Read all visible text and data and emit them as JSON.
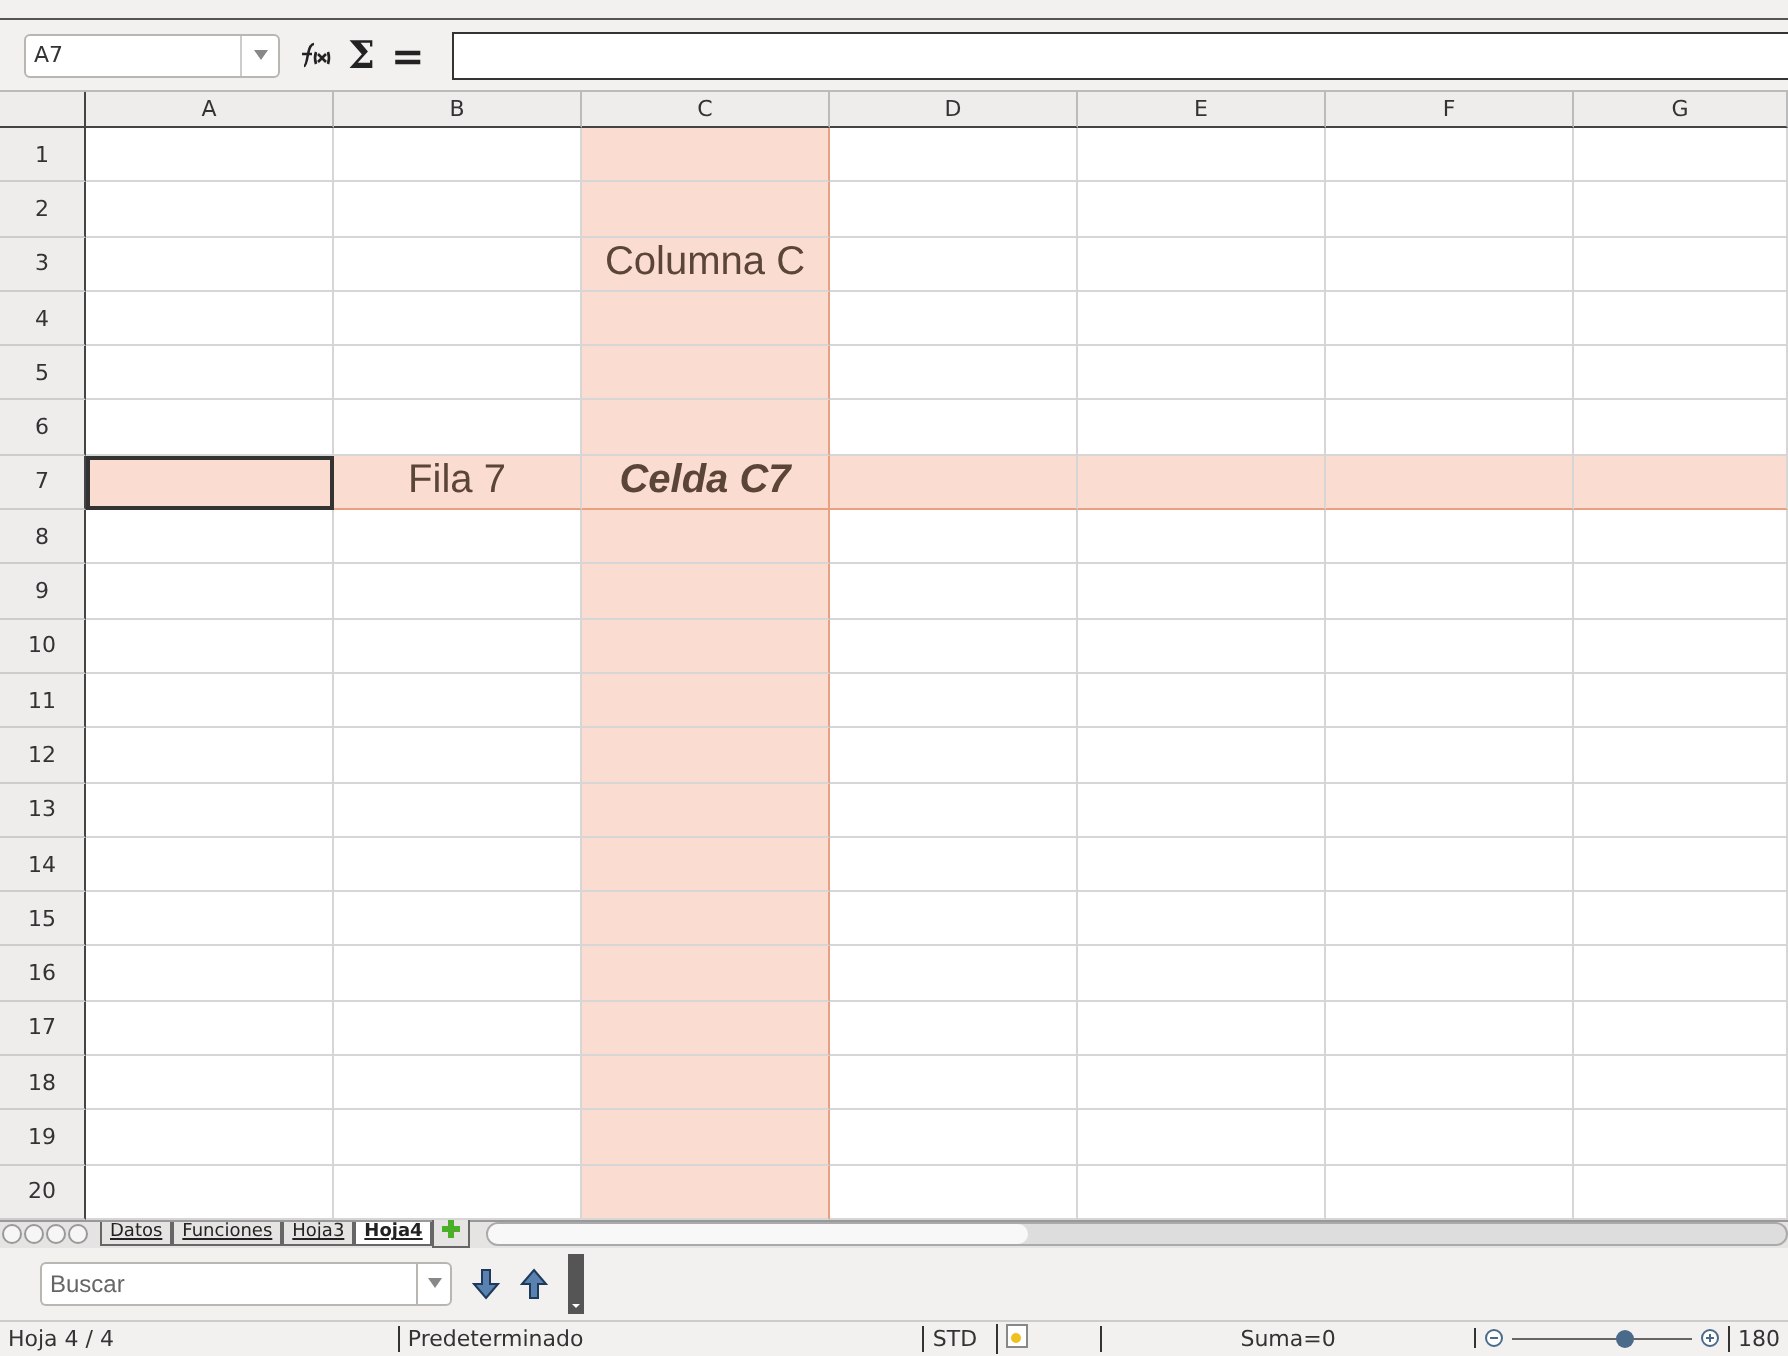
{
  "name_box": {
    "value": "A7"
  },
  "formula_toolbar": {
    "sum_symbol": "Σ",
    "equals_symbol": "="
  },
  "columns": [
    {
      "label": "A",
      "highlighted": false
    },
    {
      "label": "B",
      "highlighted": false
    },
    {
      "label": "C",
      "highlighted": true
    },
    {
      "label": "D",
      "highlighted": false
    },
    {
      "label": "E",
      "highlighted": false
    },
    {
      "label": "F",
      "highlighted": false
    },
    {
      "label": "G",
      "highlighted": false
    }
  ],
  "rows": [
    {
      "label": "1",
      "highlighted": false,
      "cells": [
        {
          "selected": false
        },
        {
          "selected": false
        },
        {
          "selected": false
        },
        {
          "selected": false
        },
        {
          "selected": false
        },
        {
          "selected": false
        },
        {
          "selected": false
        }
      ]
    },
    {
      "label": "2",
      "highlighted": false,
      "cells": [
        {
          "selected": false
        },
        {
          "selected": false
        },
        {
          "selected": false
        },
        {
          "selected": false
        },
        {
          "selected": false
        },
        {
          "selected": false
        },
        {
          "selected": false
        }
      ]
    },
    {
      "label": "3",
      "highlighted": false,
      "cells": [
        {
          "selected": false
        },
        {
          "selected": false
        },
        {
          "text": "Columna C",
          "selected": false
        },
        {
          "selected": false
        },
        {
          "selected": false
        },
        {
          "selected": false
        },
        {
          "selected": false
        }
      ]
    },
    {
      "label": "4",
      "highlighted": false,
      "cells": [
        {
          "selected": false
        },
        {
          "selected": false
        },
        {
          "selected": false
        },
        {
          "selected": false
        },
        {
          "selected": false
        },
        {
          "selected": false
        },
        {
          "selected": false
        }
      ]
    },
    {
      "label": "5",
      "highlighted": false,
      "cells": [
        {
          "selected": false
        },
        {
          "selected": false
        },
        {
          "selected": false
        },
        {
          "selected": false
        },
        {
          "selected": false
        },
        {
          "selected": false
        },
        {
          "selected": false
        }
      ]
    },
    {
      "label": "6",
      "highlighted": false,
      "cells": [
        {
          "selected": false
        },
        {
          "selected": false
        },
        {
          "selected": false
        },
        {
          "selected": false
        },
        {
          "selected": false
        },
        {
          "selected": false
        },
        {
          "selected": false
        }
      ]
    },
    {
      "label": "7",
      "highlighted": true,
      "cells": [
        {
          "selected": true
        },
        {
          "text": "Fila 7",
          "selected": false
        },
        {
          "text": "Celda C7",
          "bold": true,
          "italic": true,
          "selected": false
        },
        {
          "selected": false
        },
        {
          "selected": false
        },
        {
          "selected": false
        },
        {
          "selected": false
        }
      ]
    },
    {
      "label": "8",
      "highlighted": false,
      "cells": [
        {
          "selected": false
        },
        {
          "selected": false
        },
        {
          "selected": false
        },
        {
          "selected": false
        },
        {
          "selected": false
        },
        {
          "selected": false
        },
        {
          "selected": false
        }
      ]
    },
    {
      "label": "9",
      "highlighted": false,
      "cells": [
        {
          "selected": false
        },
        {
          "selected": false
        },
        {
          "selected": false
        },
        {
          "selected": false
        },
        {
          "selected": false
        },
        {
          "selected": false
        },
        {
          "selected": false
        }
      ]
    },
    {
      "label": "10",
      "highlighted": false,
      "cells": [
        {
          "selected": false
        },
        {
          "selected": false
        },
        {
          "selected": false
        },
        {
          "selected": false
        },
        {
          "selected": false
        },
        {
          "selected": false
        },
        {
          "selected": false
        }
      ]
    },
    {
      "label": "11",
      "highlighted": false,
      "cells": [
        {
          "selected": false
        },
        {
          "selected": false
        },
        {
          "selected": false
        },
        {
          "selected": false
        },
        {
          "selected": false
        },
        {
          "selected": false
        },
        {
          "selected": false
        }
      ]
    },
    {
      "label": "12",
      "highlighted": false,
      "cells": [
        {
          "selected": false
        },
        {
          "selected": false
        },
        {
          "selected": false
        },
        {
          "selected": false
        },
        {
          "selected": false
        },
        {
          "selected": false
        },
        {
          "selected": false
        }
      ]
    },
    {
      "label": "13",
      "highlighted": false,
      "cells": [
        {
          "selected": false
        },
        {
          "selected": false
        },
        {
          "selected": false
        },
        {
          "selected": false
        },
        {
          "selected": false
        },
        {
          "selected": false
        },
        {
          "selected": false
        }
      ]
    },
    {
      "label": "14",
      "highlighted": false,
      "cells": [
        {
          "selected": false
        },
        {
          "selected": false
        },
        {
          "selected": false
        },
        {
          "selected": false
        },
        {
          "selected": false
        },
        {
          "selected": false
        },
        {
          "selected": false
        }
      ]
    },
    {
      "label": "15",
      "highlighted": false,
      "cells": [
        {
          "selected": false
        },
        {
          "selected": false
        },
        {
          "selected": false
        },
        {
          "selected": false
        },
        {
          "selected": false
        },
        {
          "selected": false
        },
        {
          "selected": false
        }
      ]
    },
    {
      "label": "16",
      "highlighted": false,
      "cells": [
        {
          "selected": false
        },
        {
          "selected": false
        },
        {
          "selected": false
        },
        {
          "selected": false
        },
        {
          "selected": false
        },
        {
          "selected": false
        },
        {
          "selected": false
        }
      ]
    },
    {
      "label": "17",
      "highlighted": false,
      "cells": [
        {
          "selected": false
        },
        {
          "selected": false
        },
        {
          "selected": false
        },
        {
          "selected": false
        },
        {
          "selected": false
        },
        {
          "selected": false
        },
        {
          "selected": false
        }
      ]
    },
    {
      "label": "18",
      "highlighted": false,
      "cells": [
        {
          "selected": false
        },
        {
          "selected": false
        },
        {
          "selected": false
        },
        {
          "selected": false
        },
        {
          "selected": false
        },
        {
          "selected": false
        },
        {
          "selected": false
        }
      ]
    },
    {
      "label": "19",
      "highlighted": false,
      "cells": [
        {
          "selected": false
        },
        {
          "selected": false
        },
        {
          "selected": false
        },
        {
          "selected": false
        },
        {
          "selected": false
        },
        {
          "selected": false
        },
        {
          "selected": false
        }
      ]
    },
    {
      "label": "20",
      "highlighted": false,
      "cells": [
        {
          "selected": false
        },
        {
          "selected": false
        },
        {
          "selected": false
        },
        {
          "selected": false
        },
        {
          "selected": false
        },
        {
          "selected": false
        },
        {
          "selected": false
        }
      ]
    }
  ],
  "sheet_tabs": [
    {
      "label": "Datos",
      "selected": false
    },
    {
      "label": "Funciones",
      "selected": false
    },
    {
      "label": "Hoja3",
      "selected": false
    },
    {
      "label": "Hoja4",
      "selected": true
    }
  ],
  "find_bar": {
    "placeholder": "Buscar"
  },
  "status_bar": {
    "sheet": "Hoja 4 / 4",
    "page_style": "Predeterminado",
    "mode": "STD",
    "sum": "Suma=0",
    "zoom": {
      "level": 0.62,
      "reading": "180"
    }
  }
}
